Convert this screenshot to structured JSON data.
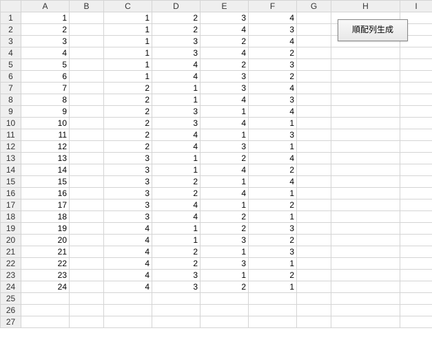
{
  "columns": [
    "A",
    "B",
    "C",
    "D",
    "E",
    "F",
    "G",
    "H",
    "I"
  ],
  "row_count": 27,
  "rows": [
    {
      "A": 1,
      "C": 1,
      "D": 2,
      "E": 3,
      "F": 4
    },
    {
      "A": 2,
      "C": 1,
      "D": 2,
      "E": 4,
      "F": 3
    },
    {
      "A": 3,
      "C": 1,
      "D": 3,
      "E": 2,
      "F": 4
    },
    {
      "A": 4,
      "C": 1,
      "D": 3,
      "E": 4,
      "F": 2
    },
    {
      "A": 5,
      "C": 1,
      "D": 4,
      "E": 2,
      "F": 3
    },
    {
      "A": 6,
      "C": 1,
      "D": 4,
      "E": 3,
      "F": 2
    },
    {
      "A": 7,
      "C": 2,
      "D": 1,
      "E": 3,
      "F": 4
    },
    {
      "A": 8,
      "C": 2,
      "D": 1,
      "E": 4,
      "F": 3
    },
    {
      "A": 9,
      "C": 2,
      "D": 3,
      "E": 1,
      "F": 4
    },
    {
      "A": 10,
      "C": 2,
      "D": 3,
      "E": 4,
      "F": 1
    },
    {
      "A": 11,
      "C": 2,
      "D": 4,
      "E": 1,
      "F": 3
    },
    {
      "A": 12,
      "C": 2,
      "D": 4,
      "E": 3,
      "F": 1
    },
    {
      "A": 13,
      "C": 3,
      "D": 1,
      "E": 2,
      "F": 4
    },
    {
      "A": 14,
      "C": 3,
      "D": 1,
      "E": 4,
      "F": 2
    },
    {
      "A": 15,
      "C": 3,
      "D": 2,
      "E": 1,
      "F": 4
    },
    {
      "A": 16,
      "C": 3,
      "D": 2,
      "E": 4,
      "F": 1
    },
    {
      "A": 17,
      "C": 3,
      "D": 4,
      "E": 1,
      "F": 2
    },
    {
      "A": 18,
      "C": 3,
      "D": 4,
      "E": 2,
      "F": 1
    },
    {
      "A": 19,
      "C": 4,
      "D": 1,
      "E": 2,
      "F": 3
    },
    {
      "A": 20,
      "C": 4,
      "D": 1,
      "E": 3,
      "F": 2
    },
    {
      "A": 21,
      "C": 4,
      "D": 2,
      "E": 1,
      "F": 3
    },
    {
      "A": 22,
      "C": 4,
      "D": 2,
      "E": 3,
      "F": 1
    },
    {
      "A": 23,
      "C": 4,
      "D": 3,
      "E": 1,
      "F": 2
    },
    {
      "A": 24,
      "C": 4,
      "D": 3,
      "E": 2,
      "F": 1
    }
  ],
  "button": {
    "label": "順配列生成"
  }
}
